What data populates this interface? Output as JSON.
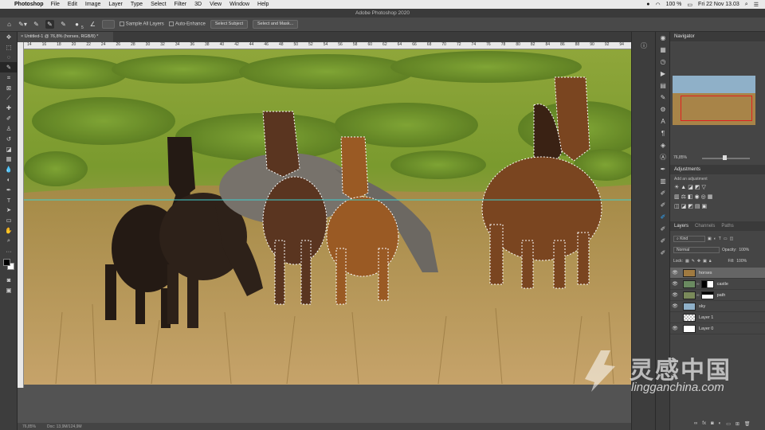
{
  "menubar": {
    "app": "Photoshop",
    "items": [
      "File",
      "Edit",
      "Image",
      "Layer",
      "Type",
      "Select",
      "Filter",
      "3D",
      "View",
      "Window",
      "Help"
    ],
    "battery": "100 %",
    "datetime": "Fri 22 Nov  13.03"
  },
  "window": {
    "title": "Adobe Photoshop 2020"
  },
  "options": {
    "brush_size": "5",
    "sample_all_layers": "Sample All Layers",
    "auto_enhance": "Auto-Enhance",
    "select_subject": "Select Subject",
    "select_and_mask": "Select and Mask..."
  },
  "document": {
    "tab_title": "Untitled-1 @ 76,8% (horses, RGB/8) *",
    "zoom": "76,85%",
    "doc_size": "Doc: 13,9M/124,9M",
    "ruler_ticks": [
      "14",
      "16",
      "18",
      "20",
      "22",
      "24",
      "26",
      "28",
      "30",
      "32",
      "34",
      "36",
      "38",
      "40",
      "42",
      "44",
      "46",
      "48",
      "50",
      "52",
      "54",
      "56",
      "58",
      "60",
      "62",
      "64",
      "66",
      "68",
      "70",
      "72",
      "74",
      "76",
      "78",
      "80",
      "82",
      "84",
      "86",
      "88",
      "90",
      "92",
      "94"
    ]
  },
  "navigator": {
    "title": "Navigator",
    "zoom": "76,85%"
  },
  "adjustments": {
    "title": "Adjustments",
    "add_label": "Add an adjustment"
  },
  "layers_panel": {
    "tabs": [
      "Layers",
      "Channels",
      "Paths"
    ],
    "filter_kind": "Kind",
    "blend_mode": "Normal",
    "opacity_label": "Opacity:",
    "opacity": "100%",
    "lock_label": "Lock:",
    "fill_label": "Fill:",
    "fill": "100%",
    "layers": [
      {
        "name": "horses",
        "has_mask": false,
        "selected": true,
        "visible": true
      },
      {
        "name": "castle",
        "has_mask": true,
        "selected": false,
        "visible": true
      },
      {
        "name": "path",
        "has_mask": true,
        "selected": false,
        "visible": true
      },
      {
        "name": "sky",
        "has_mask": false,
        "selected": false,
        "visible": true
      },
      {
        "name": "Layer 1",
        "has_mask": false,
        "selected": false,
        "visible": false
      },
      {
        "name": "Layer 0",
        "has_mask": false,
        "selected": false,
        "visible": true
      }
    ]
  },
  "watermark": {
    "brand": "灵感中国",
    "url": "lingganchina.com"
  },
  "colors": {
    "accent": "#31a8ff",
    "ui_dark": "#3d3d3d",
    "panel": "#454545",
    "guide": "#3fd0d0"
  }
}
